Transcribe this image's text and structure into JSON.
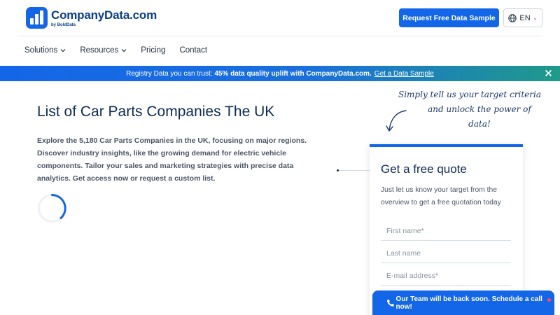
{
  "header": {
    "logo_name": "CompanyData.com",
    "logo_sub": "by BoldData",
    "cta_label": "Request Free Data Sample",
    "lang_label": "EN"
  },
  "nav": {
    "items": [
      {
        "label": "Solutions",
        "has_dropdown": true
      },
      {
        "label": "Resources",
        "has_dropdown": true
      },
      {
        "label": "Pricing",
        "has_dropdown": false
      },
      {
        "label": "Contact",
        "has_dropdown": false
      }
    ]
  },
  "banner": {
    "lead": "Registry Data you can trust:",
    "highlight": "45% data quality uplift with CompanyData.com.",
    "link": "Get a Data Sample"
  },
  "main": {
    "title": "List of Car Parts Companies The UK",
    "description": "Explore the 5,180 Car Parts Companies in the UK, focusing on major regions. Discover industry insights, like the growing demand for electric vehicle components. Tailor your sales and marketing strategies with precise data analytics. Get access now or request a custom list."
  },
  "callout": {
    "line1": "Simply tell us your target criteria",
    "line2": "and unlock the power of data!"
  },
  "quote_form": {
    "title": "Get a free quote",
    "description": "Just let us know your target from the overview to get a free quotation today",
    "fields": [
      {
        "placeholder": "First name*"
      },
      {
        "placeholder": "Last name"
      },
      {
        "placeholder": "E-mail address*"
      }
    ]
  },
  "chat": {
    "label": "Our Team will be back soon. Schedule a call now!"
  },
  "colors": {
    "brand_blue": "#1466e8",
    "heading_navy": "#0d2a55",
    "banner_teal": "#1f9a8a"
  }
}
